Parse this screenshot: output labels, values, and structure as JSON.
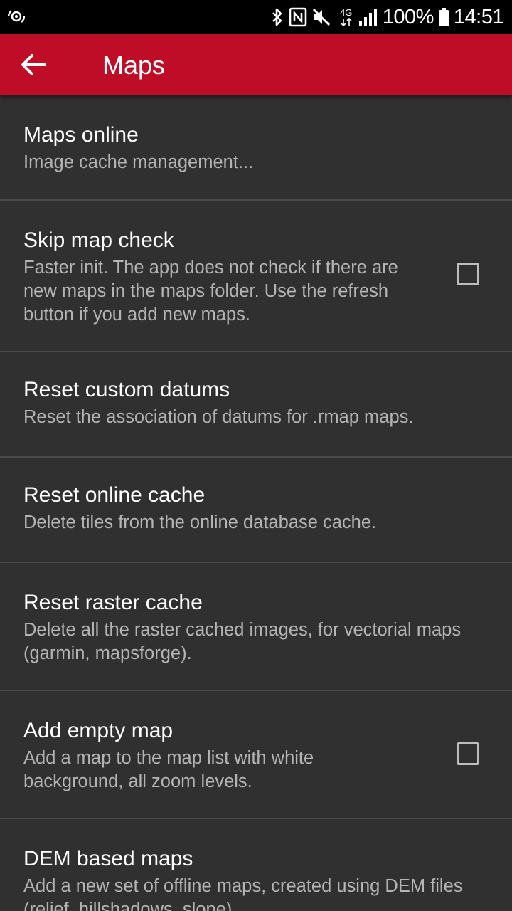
{
  "status_bar": {
    "battery": "100%",
    "time": "14:51",
    "network": "4G",
    "icons": [
      "cast-icon",
      "bluetooth-icon",
      "nfc-icon",
      "mute-icon",
      "4g-data-icon",
      "signal-icon",
      "battery-icon"
    ]
  },
  "app_bar": {
    "title": "Maps",
    "background_color": "#c00d27",
    "back_icon": "arrow-left-icon"
  },
  "settings": {
    "items": [
      {
        "title": "Maps online",
        "summary": "Image cache management..."
      },
      {
        "title": "Skip map check",
        "summary": "Faster init. The app does not check if there are new maps in the maps folder. Use the refresh button if you add new maps.",
        "checked": false
      },
      {
        "title": "Reset custom datums",
        "summary": "Reset the association of datums for .rmap maps."
      },
      {
        "title": "Reset online cache",
        "summary": "Delete tiles from the online database cache."
      },
      {
        "title": "Reset raster cache",
        "summary": "Delete all the raster cached images, for vectorial maps (garmin, mapsforge)."
      },
      {
        "title": "Add empty map",
        "summary": "Add a map to the map list with white background, all zoom levels.",
        "checked": false
      },
      {
        "title": "DEM based maps",
        "summary": "Add a new set of offline maps, created using DEM files (relief, hillshadows, slope)"
      }
    ]
  }
}
